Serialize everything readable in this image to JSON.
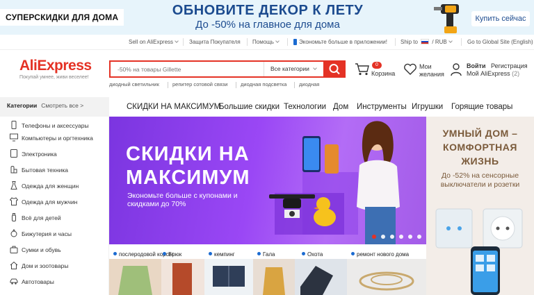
{
  "promo": {
    "badge": "СУПЕРСКИДКИ ДЛЯ ДОМА",
    "headline": "ОБНОВИТЕ ДЕКОР К ЛЕТУ",
    "subline": "До -50% на главное для дома",
    "button": "Купить сейчас"
  },
  "topnav": {
    "sell": "Sell on AliExpress",
    "protection": "Защита Покупателя",
    "help": "Помощь",
    "app": "Экономьте больше в приложении!",
    "ship_to": "Ship to",
    "currency": "/ RUB",
    "global": "Go to Global Site (English)"
  },
  "header": {
    "logo": "AliExpress",
    "tagline": "Покупай умнее, живи веселее!",
    "search_placeholder": "-50% на товары Gillette",
    "search_category": "Все категории",
    "hints": [
      "диодный светильник",
      "репитер сотовой связи",
      "диодная подсветка",
      "диодная"
    ],
    "cart_label": "Корзина",
    "cart_count": "0",
    "wishlist_line1": "Мои",
    "wishlist_line2": "желания",
    "signin": "Войти",
    "register": "Регистрация",
    "my_ali": "Мой AliExpress",
    "my_ali_count": "(2)"
  },
  "categories": {
    "title": "Категории",
    "see_all": "Смотреть все >",
    "items": [
      "Телефоны и аксессуары",
      "Компьютеры и оргтехника",
      "Электроника",
      "Бытовая техника",
      "Одежда для женщин",
      "Одежда для мужчин",
      "Всё для детей",
      "Бижутерия и часы",
      "Сумки и обувь",
      "Дом и зоотовары",
      "Автотовары"
    ]
  },
  "tabs": [
    "СКИДКИ НА МАКСИМУМ",
    "Большие скидки",
    "Технологии",
    "Дом",
    "Инструменты",
    "Игрушки",
    "Горящие товары"
  ],
  "hero": {
    "title_line1": "СКИДКИ НА",
    "title_line2": "МАКСИМУМ",
    "subtitle": "Экономьте больше с купонами и скидками до 70%",
    "slide_count": 6,
    "active_slide": 1
  },
  "right_promo": {
    "title": "УМНЫЙ ДОМ – КОМФОРТНАЯ ЖИЗНЬ",
    "subtitle": "До -52% на сенсорные выключатели и розетки"
  },
  "strips": [
    "послеродовой корсет",
    "Брюк",
    "кемпинг",
    "Гала",
    "Охота",
    "ремонт нового дома"
  ],
  "colors": {
    "accent": "#e43225",
    "hero": "#8a3cf0",
    "promo_bg": "#e7f4fb",
    "promo_text": "#1c4b8f"
  }
}
